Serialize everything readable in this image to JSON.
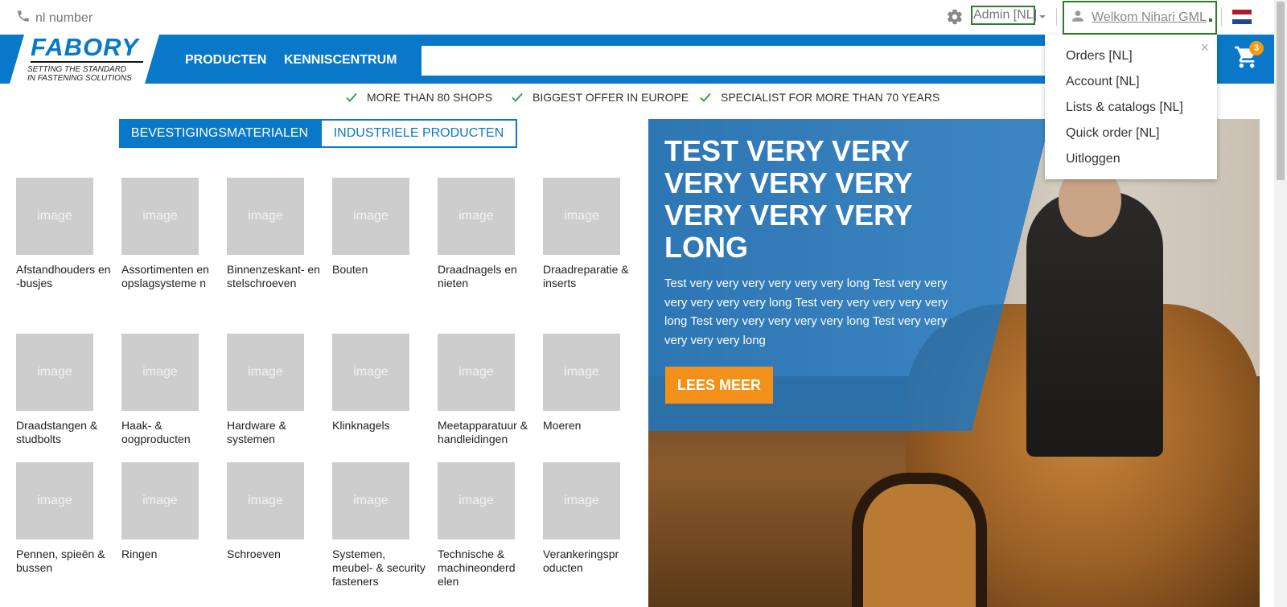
{
  "topbar": {
    "phone_label": "nl number",
    "admin_label": "Admin [NL]",
    "welcome_label": "Welkom Nihari GML"
  },
  "colors": {
    "brand_blue": "#0a78c9",
    "accent_orange": "#f39019",
    "check_green": "#1a9e3f",
    "focus_green": "#2a7b2a"
  },
  "logo": {
    "word": "FABORY",
    "tagline_line1": "SETTING THE STANDARD",
    "tagline_line2": "IN FASTENING SOLUTIONS"
  },
  "nav": {
    "products": "PRODUCTEN",
    "knowledge": "KENNISCENTRUM",
    "search_placeholder": "",
    "cart_count": "3"
  },
  "usps": [
    "MORE THAN 80 SHOPS",
    "BIGGEST OFFER IN EUROPE",
    "SPECIALIST FOR MORE THAN 70 YEARS"
  ],
  "tabs": {
    "active": "BEVESTIGINGSMATERIALEN",
    "inactive": "INDUSTRIELE PRODUCTEN"
  },
  "image_placeholder": "image",
  "categories": [
    "Afstandhouders en -busjes",
    "Assortimenten en opslagsysteme n",
    "Binnenzeskant- en stelschroeven",
    "Bouten",
    "Draadnagels en nieten",
    "Draadreparatie & inserts",
    "Draadstangen & studbolts",
    "Haak- & oogproducten",
    "Hardware & systemen",
    "Klinknagels",
    "Meetapparatuur & handleidingen",
    "Moeren",
    "Pennen, spieën & bussen",
    "Ringen",
    "Schroeven",
    "Systemen, meubel- & security fasteners",
    "Technische & machineonderd elen",
    "Verankeringspr oducten"
  ],
  "hero": {
    "title": "TEST VERY VERY VERY VERY VERY VERY VERY VERY LONG",
    "text": "Test very very very very very very long Test very very very very very very long Test very very very very very long Test very very very very very long Test very very very very very long",
    "button": "LEES MEER"
  },
  "dropdown": {
    "close": "×",
    "items": [
      "Orders [NL]",
      "Account [NL]",
      "Lists & catalogs [NL]",
      "Quick order [NL]",
      "Uitloggen"
    ]
  }
}
